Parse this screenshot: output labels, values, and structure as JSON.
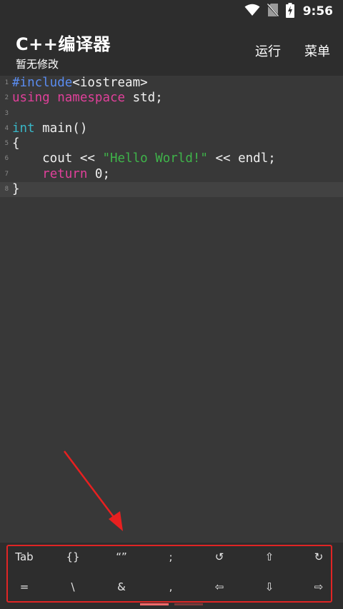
{
  "status_bar": {
    "time": "9:56"
  },
  "app_bar": {
    "title": "C++编译器",
    "subtitle": "暂无修改",
    "actions": {
      "run": "运行",
      "menu": "菜单"
    }
  },
  "editor": {
    "lines": [
      {
        "num": "1",
        "tokens": [
          {
            "t": "#include",
            "c": "kw-pre"
          },
          {
            "t": "<iostream>",
            "c": ""
          }
        ]
      },
      {
        "num": "2",
        "tokens": [
          {
            "t": "using",
            "c": "kw-pink"
          },
          {
            "t": " ",
            "c": ""
          },
          {
            "t": "namespace",
            "c": "kw-pink"
          },
          {
            "t": " std;",
            "c": ""
          }
        ]
      },
      {
        "num": "3",
        "tokens": []
      },
      {
        "num": "4",
        "tokens": [
          {
            "t": "int",
            "c": "kw-type"
          },
          {
            "t": " main()",
            "c": ""
          }
        ]
      },
      {
        "num": "5",
        "tokens": [
          {
            "t": "{",
            "c": ""
          }
        ]
      },
      {
        "num": "6",
        "tokens": [
          {
            "t": "    cout << ",
            "c": ""
          },
          {
            "t": "\"Hello World!\"",
            "c": "str"
          },
          {
            "t": " << endl;",
            "c": ""
          }
        ]
      },
      {
        "num": "7",
        "tokens": [
          {
            "t": "    ",
            "c": ""
          },
          {
            "t": "return",
            "c": "kw-pink"
          },
          {
            "t": " 0;",
            "c": ""
          }
        ]
      },
      {
        "num": "8",
        "tokens": [
          {
            "t": "}",
            "c": ""
          }
        ],
        "highlight": true
      }
    ]
  },
  "keyboard": {
    "row1": [
      "Tab",
      "{}",
      "“”",
      ";",
      "↺",
      "⇧",
      "↻"
    ],
    "row2": [
      "=",
      "\\",
      "&",
      ",",
      "⇦",
      "⇩",
      "⇨"
    ],
    "row1_names": [
      "key-tab",
      "key-braces",
      "key-quotes",
      "key-semicolon",
      "key-undo",
      "key-shift-up",
      "key-redo"
    ],
    "row2_names": [
      "key-equals",
      "key-backslash",
      "key-ampersand",
      "key-comma",
      "key-arrow-left",
      "key-arrow-down",
      "key-arrow-right"
    ]
  },
  "colors": {
    "background": "#383838",
    "bar": "#2d2d2d",
    "highlight_frame": "#e02525",
    "preprocessor": "#5a8cf0",
    "keyword": "#e0409a",
    "type": "#38b8c8",
    "string": "#3fb44a"
  }
}
